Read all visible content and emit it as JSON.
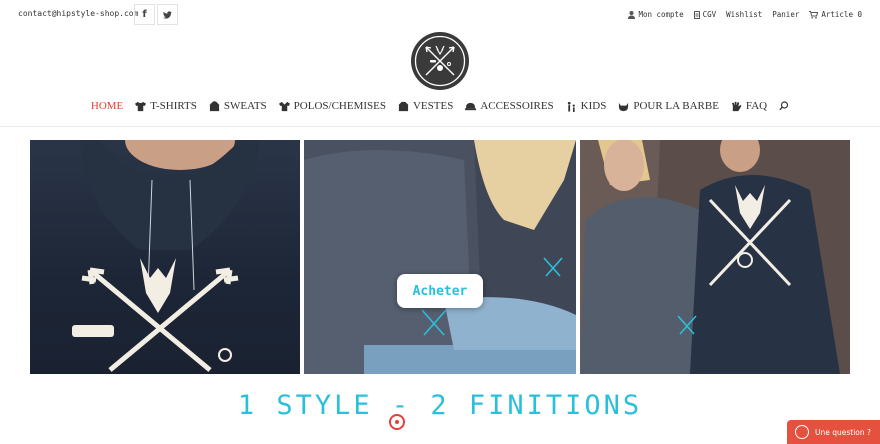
{
  "topbar": {
    "contact_email": "contact@hipstyle-shop.com",
    "social": [
      {
        "name": "facebook",
        "glyph": "f"
      },
      {
        "name": "twitter",
        "glyph": "t"
      }
    ],
    "links": [
      {
        "icon": "user-icon",
        "label": "Mon compte"
      },
      {
        "icon": "document-icon",
        "label": "CGV"
      },
      {
        "icon": "",
        "label": "Wishlist"
      },
      {
        "icon": "",
        "label": "Panier"
      },
      {
        "icon": "cart-icon",
        "label": "Article 0"
      }
    ]
  },
  "nav": {
    "items": [
      {
        "label": "HOME",
        "active": true
      },
      {
        "label": "T-SHIRTS"
      },
      {
        "label": "SWEATS"
      },
      {
        "label": "POLOS/CHEMISES"
      },
      {
        "label": "VESTES"
      },
      {
        "label": "ACCESSOIRES"
      },
      {
        "label": "KIDS"
      },
      {
        "label": "POUR LA BARBE"
      },
      {
        "label": "FAQ"
      }
    ]
  },
  "hero": {
    "buy_label": "Acheter",
    "headline": "1 STYLE - 2 FINITIONS"
  },
  "chat": {
    "label": "Une question ?"
  },
  "colors": {
    "accent": "#2ac0dc",
    "nav_active": "#e53e2e",
    "chat_bg": "#e4513f"
  }
}
